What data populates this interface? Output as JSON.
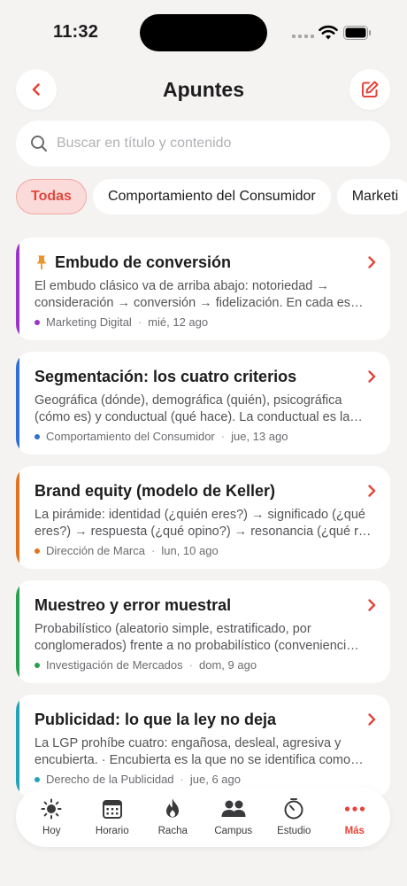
{
  "status_bar": {
    "time": "11:32"
  },
  "header": {
    "title": "Apuntes"
  },
  "search": {
    "placeholder": "Buscar en título y contenido"
  },
  "chips": [
    {
      "label": "Todas",
      "active": true
    },
    {
      "label": "Comportamiento del Consumidor",
      "active": false
    },
    {
      "label": "Marketi",
      "active": false
    }
  ],
  "notes": [
    {
      "title": "Embudo de conversión",
      "pinned": true,
      "body": "El embudo clásico va de arriba abajo: notoriedad → consideración → conversión → fidelización. En cada es…",
      "subject": "Marketing Digital",
      "date": "mié, 12 ago",
      "color": "#9b35c9"
    },
    {
      "title": "Segmentación: los cuatro criterios",
      "pinned": false,
      "body": "Geográfica (dónde), demográfica (quién), psicográfica (cómo es) y conductual (qué hace). La conductual es la…",
      "subject": "Comportamiento del Consumidor",
      "date": "jue, 13 ago",
      "color": "#2f6fd6"
    },
    {
      "title": "Brand equity (modelo de Keller)",
      "pinned": false,
      "body": "La pirámide: identidad (¿quién eres?) → significado (¿qué eres?) → respuesta (¿qué opino?) → resonancia (¿qué r…",
      "subject": "Dirección de Marca",
      "date": "lun, 10 ago",
      "color": "#e07420"
    },
    {
      "title": "Muestreo y error muestral",
      "pinned": false,
      "body": "Probabilístico (aleatorio simple, estratificado, por conglomerados) frente a no probabilístico (convenienci…",
      "subject": "Investigación de Mercados",
      "date": "dom, 9 ago",
      "color": "#27a150"
    },
    {
      "title": "Publicidad: lo que la ley no deja",
      "pinned": false,
      "body": "La LGP prohíbe cuatro: engañosa, desleal, agresiva y encubierta. · Encubierta es la que no se identifica como…",
      "subject": "Derecho de la Publicidad",
      "date": "jue, 6 ago",
      "color": "#23a3b8"
    }
  ],
  "tabs": [
    {
      "label": "Hoy",
      "icon": "sun-icon",
      "active": false
    },
    {
      "label": "Horario",
      "icon": "calendar-icon",
      "active": false
    },
    {
      "label": "Racha",
      "icon": "flame-icon",
      "active": false
    },
    {
      "label": "Campus",
      "icon": "people-icon",
      "active": false
    },
    {
      "label": "Estudio",
      "icon": "timer-icon",
      "active": false
    },
    {
      "label": "Más",
      "icon": "more-icon",
      "active": true
    }
  ],
  "colors": {
    "accent": "#e5443a",
    "background": "#f4f3f1",
    "pin": "#e8952a"
  }
}
